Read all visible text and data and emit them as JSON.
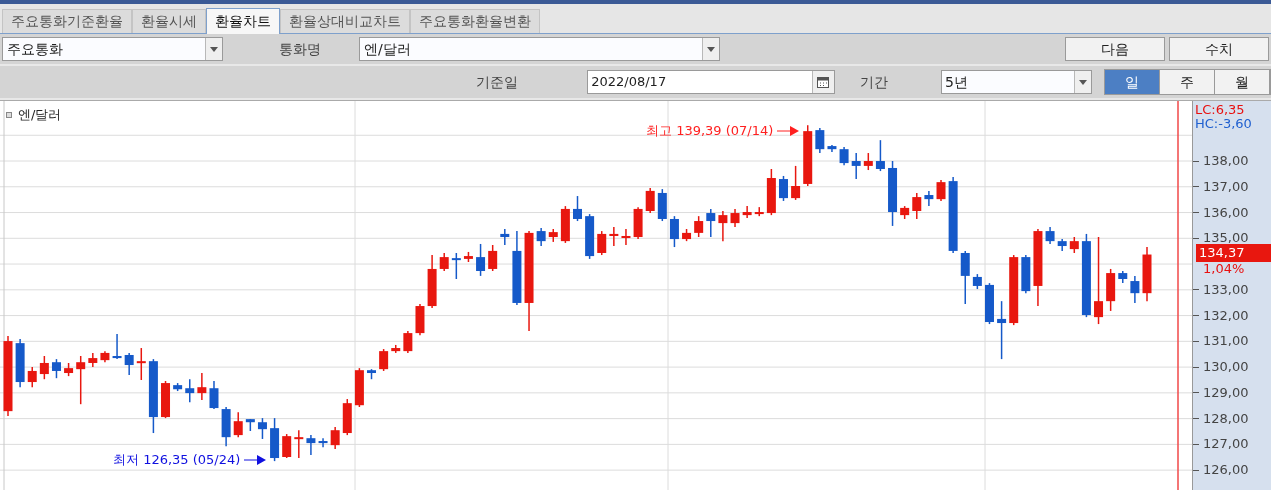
{
  "tabs": [
    {
      "label": "주요통화기준환율",
      "selected": false
    },
    {
      "label": "환율시세",
      "selected": false
    },
    {
      "label": "환율차트",
      "selected": true
    },
    {
      "label": "환율상대비교차트",
      "selected": false
    },
    {
      "label": "주요통화환율변환",
      "selected": false
    }
  ],
  "filter": {
    "category": "주요통화",
    "currency_label": "통화명",
    "currency": "엔/달러"
  },
  "buttons": [
    "다음",
    "수치"
  ],
  "date": {
    "label": "기준일",
    "value": "2022/08/17"
  },
  "period": {
    "label": "기간",
    "value": "5년"
  },
  "intervals": [
    {
      "label": "일",
      "selected": true
    },
    {
      "label": "주",
      "selected": false
    },
    {
      "label": "월",
      "selected": false
    }
  ],
  "chart": {
    "legend": "엔/달러",
    "high_note": "최고 139,39 (07/14)",
    "low_note": "최저 126,35 (05/24)",
    "lc": "LC:6,35",
    "hc": "HC:-3,60",
    "price": "134,37",
    "change": "1,04%",
    "chart_data": {
      "type": "candlestick",
      "grid": true,
      "ylim": [
        125.19,
        140.33
      ],
      "yticks": [
        {
          "value": 138,
          "label": "138,00"
        },
        {
          "value": 137,
          "label": "137,00"
        },
        {
          "value": 136,
          "label": "136,00"
        },
        {
          "value": 135,
          "label": "135,00"
        },
        {
          "value": 133,
          "label": "133,00"
        },
        {
          "value": 132,
          "label": "132,00"
        },
        {
          "value": 131,
          "label": "131,00"
        },
        {
          "value": 130,
          "label": "130,00"
        },
        {
          "value": 129,
          "label": "129,00"
        },
        {
          "value": 128,
          "label": "128,00"
        },
        {
          "value": 127,
          "label": "127,00"
        },
        {
          "value": 126,
          "label": "126,00"
        }
      ],
      "ohlc": [
        [
          128.29,
          131.21,
          128.1,
          131.01
        ],
        [
          130.93,
          131.09,
          129.22,
          129.42
        ],
        [
          129.42,
          130.0,
          129.22,
          129.85
        ],
        [
          129.73,
          130.43,
          129.53,
          130.16
        ],
        [
          130.19,
          130.31,
          129.57,
          129.85
        ],
        [
          129.77,
          130.16,
          129.65,
          129.96
        ],
        [
          129.92,
          130.43,
          128.56,
          130.19
        ],
        [
          130.16,
          130.55,
          130.0,
          130.35
        ],
        [
          130.27,
          130.62,
          130.19,
          130.55
        ],
        [
          130.43,
          131.28,
          130.31,
          130.35
        ],
        [
          130.47,
          130.55,
          129.69,
          130.08
        ],
        [
          130.16,
          130.74,
          129.5,
          130.23
        ],
        [
          130.23,
          130.31,
          127.44,
          128.06
        ],
        [
          128.06,
          129.46,
          128.02,
          129.38
        ],
        [
          129.3,
          129.38,
          129.07,
          129.14
        ],
        [
          129.18,
          129.53,
          128.64,
          128.99
        ],
        [
          128.99,
          129.77,
          128.72,
          129.22
        ],
        [
          129.18,
          129.46,
          128.37,
          128.41
        ],
        [
          128.37,
          128.45,
          126.93,
          127.28
        ],
        [
          127.36,
          128.25,
          127.28,
          127.9
        ],
        [
          127.98,
          127.98,
          127.52,
          127.86
        ],
        [
          127.86,
          128.02,
          127.21,
          127.59
        ],
        [
          127.63,
          128.02,
          126.35,
          126.47
        ],
        [
          126.51,
          127.4,
          126.47,
          127.32
        ],
        [
          127.21,
          127.55,
          126.47,
          127.28
        ],
        [
          127.24,
          127.36,
          126.59,
          127.05
        ],
        [
          127.13,
          127.24,
          126.89,
          127.05
        ],
        [
          126.97,
          127.67,
          126.82,
          127.55
        ],
        [
          127.44,
          128.76,
          127.36,
          128.6
        ],
        [
          128.52,
          129.96,
          128.45,
          129.88
        ],
        [
          129.88,
          129.92,
          129.53,
          129.77
        ],
        [
          129.92,
          130.7,
          129.85,
          130.62
        ],
        [
          130.62,
          130.86,
          130.55,
          130.74
        ],
        [
          130.62,
          131.4,
          130.55,
          131.32
        ],
        [
          131.32,
          132.45,
          131.24,
          132.37
        ],
        [
          132.37,
          134.35,
          132.29,
          133.81
        ],
        [
          133.81,
          134.43,
          133.73,
          134.27
        ],
        [
          134.23,
          134.43,
          133.42,
          134.16
        ],
        [
          134.2,
          134.47,
          134.08,
          134.31
        ],
        [
          134.27,
          134.78,
          133.54,
          133.73
        ],
        [
          133.81,
          134.74,
          133.73,
          134.51
        ],
        [
          135.17,
          135.36,
          134.74,
          135.05
        ],
        [
          134.51,
          135.28,
          132.41,
          132.49
        ],
        [
          132.49,
          135.28,
          131.4,
          135.21
        ],
        [
          135.28,
          135.4,
          134.7,
          134.89
        ],
        [
          135.05,
          135.36,
          134.86,
          135.24
        ],
        [
          134.89,
          136.25,
          134.82,
          136.14
        ],
        [
          136.14,
          136.64,
          135.67,
          135.75
        ],
        [
          135.86,
          135.94,
          134.2,
          134.31
        ],
        [
          134.43,
          135.28,
          134.35,
          135.17
        ],
        [
          135.09,
          135.44,
          134.7,
          135.17
        ],
        [
          135.01,
          135.36,
          134.74,
          135.09
        ],
        [
          135.05,
          136.21,
          134.97,
          136.14
        ],
        [
          136.06,
          136.95,
          135.98,
          136.84
        ],
        [
          136.76,
          136.91,
          135.67,
          135.75
        ],
        [
          135.75,
          135.86,
          134.66,
          134.97
        ],
        [
          134.97,
          135.36,
          134.89,
          135.21
        ],
        [
          135.21,
          135.86,
          135.05,
          135.67
        ],
        [
          135.98,
          136.14,
          135.05,
          135.67
        ],
        [
          135.59,
          136.06,
          134.89,
          135.9
        ],
        [
          135.59,
          136.14,
          135.44,
          135.98
        ],
        [
          135.9,
          136.25,
          135.79,
          136.02
        ],
        [
          135.94,
          136.21,
          135.86,
          136.02
        ],
        [
          135.98,
          137.69,
          135.9,
          137.34
        ],
        [
          137.3,
          137.42,
          136.45,
          136.56
        ],
        [
          136.56,
          137.81,
          136.49,
          137.03
        ],
        [
          137.11,
          139.39,
          137.03,
          139.16
        ],
        [
          139.2,
          139.28,
          138.31,
          138.46
        ],
        [
          138.58,
          138.62,
          138.35,
          138.46
        ],
        [
          138.46,
          138.54,
          137.84,
          137.92
        ],
        [
          138.0,
          138.31,
          137.3,
          137.81
        ],
        [
          137.81,
          138.31,
          137.65,
          138.0
        ],
        [
          138.0,
          138.81,
          137.61,
          137.69
        ],
        [
          137.73,
          138.0,
          135.48,
          136.02
        ],
        [
          135.9,
          136.25,
          135.75,
          136.18
        ],
        [
          136.06,
          136.76,
          135.75,
          136.6
        ],
        [
          136.68,
          136.84,
          136.25,
          136.52
        ],
        [
          136.52,
          137.26,
          136.45,
          137.18
        ],
        [
          137.22,
          137.38,
          134.43,
          134.51
        ],
        [
          134.43,
          134.51,
          132.45,
          133.54
        ],
        [
          133.5,
          133.61,
          133.03,
          133.15
        ],
        [
          133.19,
          133.26,
          131.67,
          131.75
        ],
        [
          131.87,
          132.56,
          130.31,
          131.71
        ],
        [
          131.71,
          134.35,
          131.63,
          134.27
        ],
        [
          134.27,
          134.35,
          132.87,
          132.95
        ],
        [
          133.15,
          135.36,
          132.37,
          135.28
        ],
        [
          135.28,
          135.44,
          134.78,
          134.89
        ],
        [
          134.89,
          134.97,
          134.51,
          134.7
        ],
        [
          134.58,
          135.05,
          134.43,
          134.89
        ],
        [
          134.89,
          135.17,
          131.94,
          132.02
        ],
        [
          131.94,
          135.05,
          131.67,
          132.56
        ],
        [
          132.56,
          133.81,
          132.18,
          133.65
        ],
        [
          133.65,
          133.73,
          133.26,
          133.42
        ],
        [
          133.34,
          133.54,
          132.49,
          132.87
        ],
        [
          132.87,
          134.66,
          132.56,
          134.37
        ]
      ]
    }
  }
}
